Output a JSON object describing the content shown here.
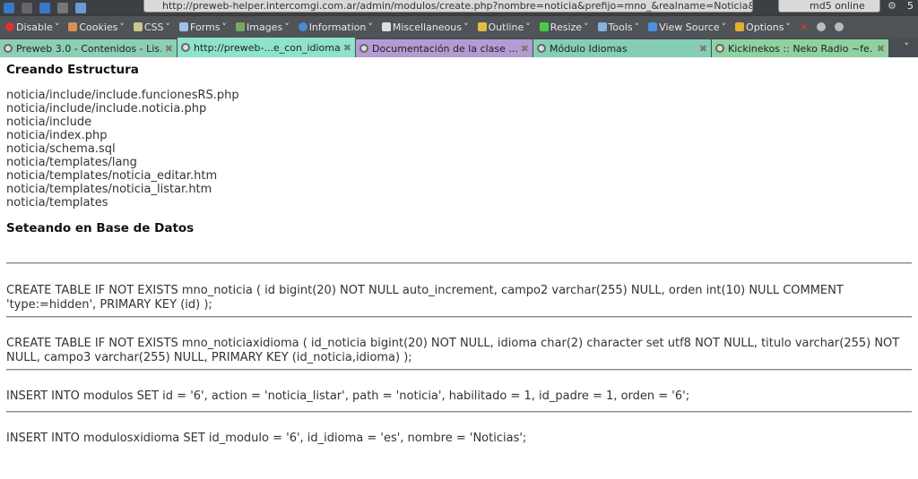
{
  "browser": {
    "url": "http://preweb-helper.intercomgi.com.ar/admin/modulos/create.php?nombre=noticia&prefijo=mno_&realname=Noticia&plur",
    "search_value": "md5 online",
    "badge": "5",
    "toolbar": [
      "Disable",
      "Cookies",
      "CSS",
      "Forms",
      "Images",
      "Information",
      "Miscellaneous",
      "Outline",
      "Resize",
      "Tools",
      "View Source",
      "Options"
    ],
    "tabs": [
      {
        "label": "Preweb 3.0 - Contenidos - Lis...",
        "color": "#8ccfb4"
      },
      {
        "label": "http://preweb-...e_con_idiomas",
        "color": "#8ee3cc",
        "active": true
      },
      {
        "label": "Documentación de la clase ...",
        "color": "#b59bd3"
      },
      {
        "label": "Módulo Idiomas",
        "color": "#86cdb5"
      },
      {
        "label": "Kickinekos :: Neko Radio ~fe...",
        "color": "#8fd2a0"
      }
    ]
  },
  "page": {
    "heading1": "Creando Estructura",
    "files": [
      "noticia/include/include.funcionesRS.php",
      "noticia/include/include.noticia.php",
      "noticia/include",
      "noticia/index.php",
      "noticia/schema.sql",
      "noticia/templates/lang",
      "noticia/templates/noticia_editar.htm",
      "noticia/templates/noticia_listar.htm",
      "noticia/templates"
    ],
    "heading2": "Seteando en Base de Datos",
    "queries": [
      "CREATE TABLE IF NOT EXISTS mno_noticia ( id bigint(20) NOT NULL auto_increment, campo2 varchar(255) NULL, orden int(10) NULL COMMENT 'type:=hidden', PRIMARY KEY (id) );",
      "CREATE TABLE IF NOT EXISTS mno_noticiaxidioma ( id_noticia bigint(20) NOT NULL, idioma char(2) character set utf8 NOT NULL, titulo varchar(255) NOT NULL, campo3 varchar(255) NULL, PRIMARY KEY (id_noticia,idioma) );",
      "INSERT INTO modulos SET id = '6', action = 'noticia_listar', path = 'noticia', habilitado = 1, id_padre = 1, orden = '6';",
      "INSERT INTO modulosxidioma SET id_modulo = '6', id_idioma = 'es', nombre = 'Noticias';"
    ]
  }
}
